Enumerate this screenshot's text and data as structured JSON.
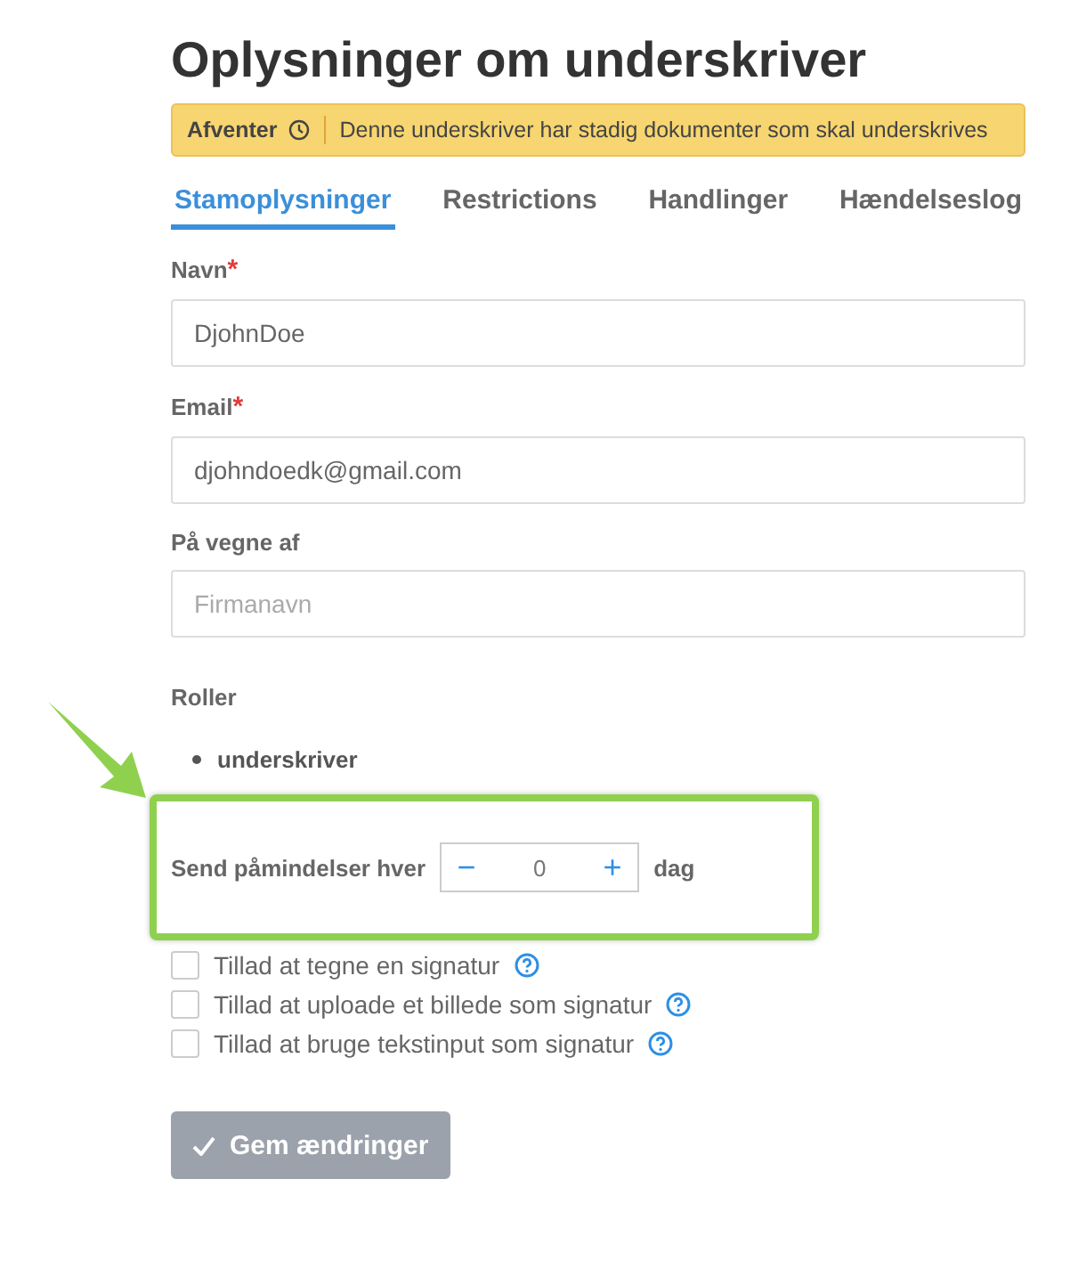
{
  "title": "Oplysninger om underskriver",
  "status_banner": {
    "status": "Afventer",
    "message": "Denne underskriver har stadig dokumenter som skal underskrives"
  },
  "tabs": [
    {
      "label": "Stamoplysninger",
      "selected": true
    },
    {
      "label": "Restrictions",
      "selected": false
    },
    {
      "label": "Handlinger",
      "selected": false
    },
    {
      "label": "Hændelseslog",
      "selected": false
    }
  ],
  "fields": [
    {
      "label": "Navn",
      "required_mark": "*",
      "value": "DjohnDoe"
    },
    {
      "label": "Email",
      "required_mark": "*",
      "value": "djohndoedk@gmail.com"
    },
    {
      "label": "På vegne af",
      "placeholder": "Firmanavn"
    }
  ],
  "roles": {
    "label": "Roller",
    "items": [
      "underskriver"
    ]
  },
  "reminder": {
    "label": "Send påmindelser hver",
    "minus": "−",
    "value": "0",
    "plus": "+",
    "unit": "dag"
  },
  "options": [
    {
      "label": "Tillad at tegne en signatur",
      "checked": false
    },
    {
      "label": "Tillad at uploade et billede som signatur",
      "checked": false
    },
    {
      "label": "Tillad at bruge tekstinput som signatur",
      "checked": false
    }
  ],
  "save_button": {
    "label": "Gem ændringer"
  }
}
